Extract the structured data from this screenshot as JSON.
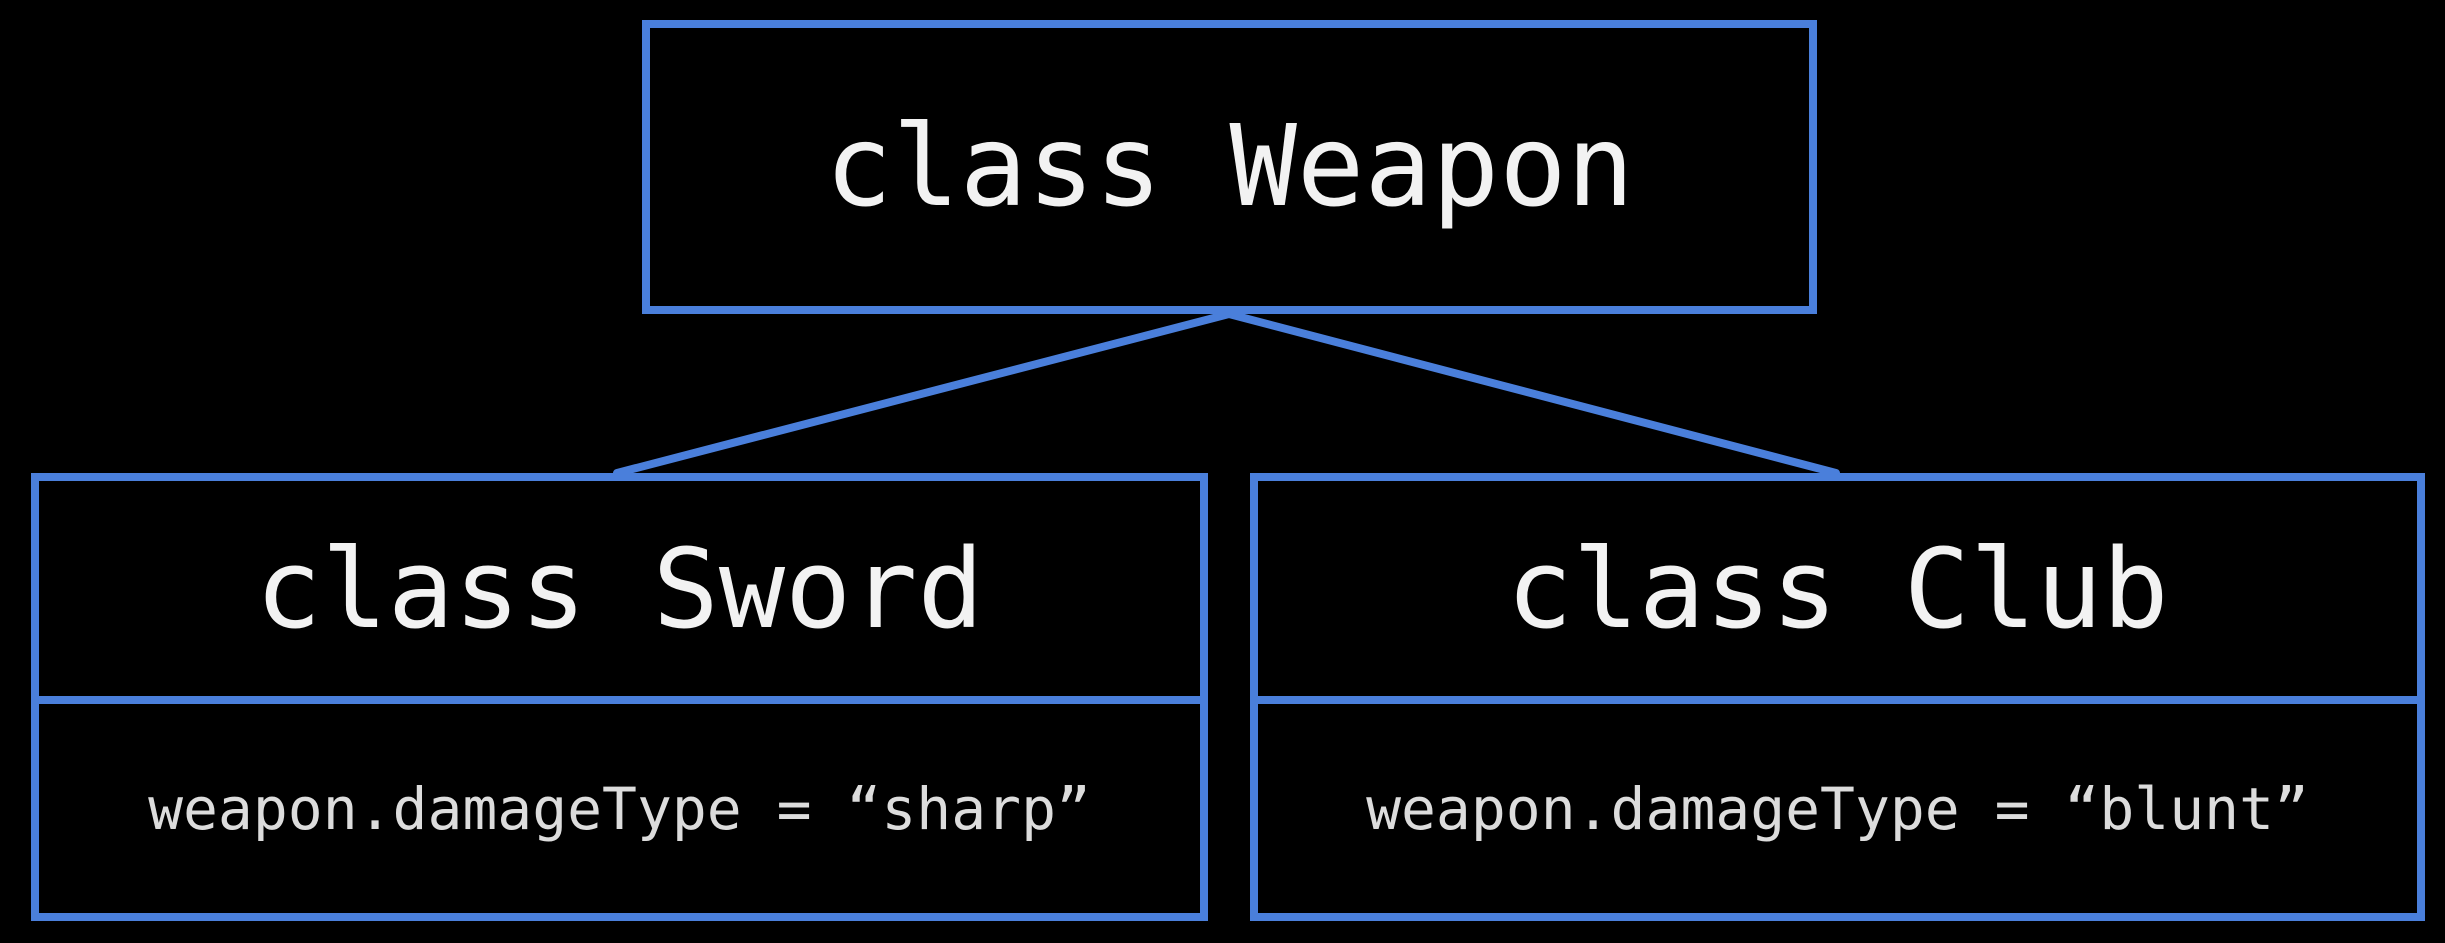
{
  "diagram": {
    "type": "class-hierarchy",
    "accent_color": "#4a7fdb",
    "background_color": "#000000",
    "parent": {
      "title": "class Weapon"
    },
    "children": [
      {
        "title": "class Sword",
        "property": "weapon.damageType = “sharp”"
      },
      {
        "title": "class Club",
        "property": "weapon.damageType = “blunt”"
      }
    ]
  }
}
